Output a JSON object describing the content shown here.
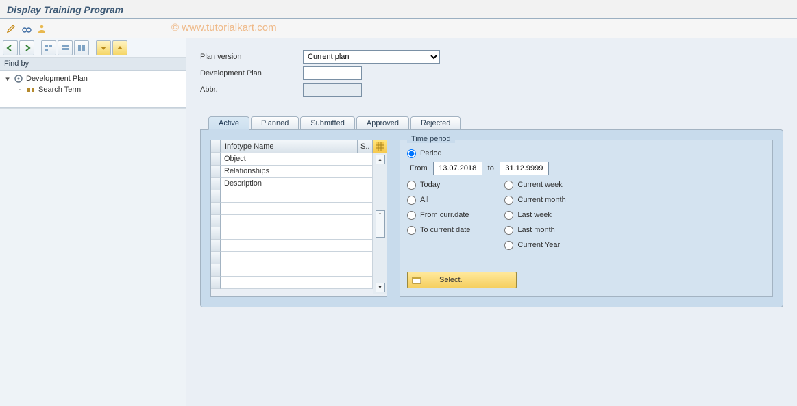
{
  "window": {
    "title": "Display Training Program"
  },
  "watermark": "© www.tutorialkart.com",
  "sidebar": {
    "findby_label": "Find by",
    "tree": {
      "root": {
        "label": "Development Plan"
      },
      "child": {
        "label": "Search Term"
      }
    }
  },
  "form": {
    "plan_version": {
      "label": "Plan version",
      "value": "Current plan"
    },
    "dev_plan": {
      "label": "Development Plan",
      "value": ""
    },
    "abbr": {
      "label": "Abbr.",
      "value": ""
    }
  },
  "tabs": {
    "active": "Active",
    "planned": "Planned",
    "submitted": "Submitted",
    "approved": "Approved",
    "rejected": "Rejected"
  },
  "infotable": {
    "header_name": "Infotype Name",
    "header_s": "S..",
    "rows": [
      {
        "name": "Object"
      },
      {
        "name": "Relationships"
      },
      {
        "name": "Description"
      }
    ]
  },
  "period": {
    "group_title": "Time period",
    "opts": {
      "period": "Period",
      "from_lbl": "From",
      "to_lbl": "to",
      "from_val": "13.07.2018",
      "to_val": "31.12.9999",
      "today": "Today",
      "all": "All",
      "from_curr": "From curr.date",
      "to_curr": "To current date",
      "cur_week": "Current week",
      "cur_month": "Current month",
      "last_week": "Last week",
      "last_month": "Last month",
      "cur_year": "Current Year"
    },
    "select_btn": "Select."
  }
}
